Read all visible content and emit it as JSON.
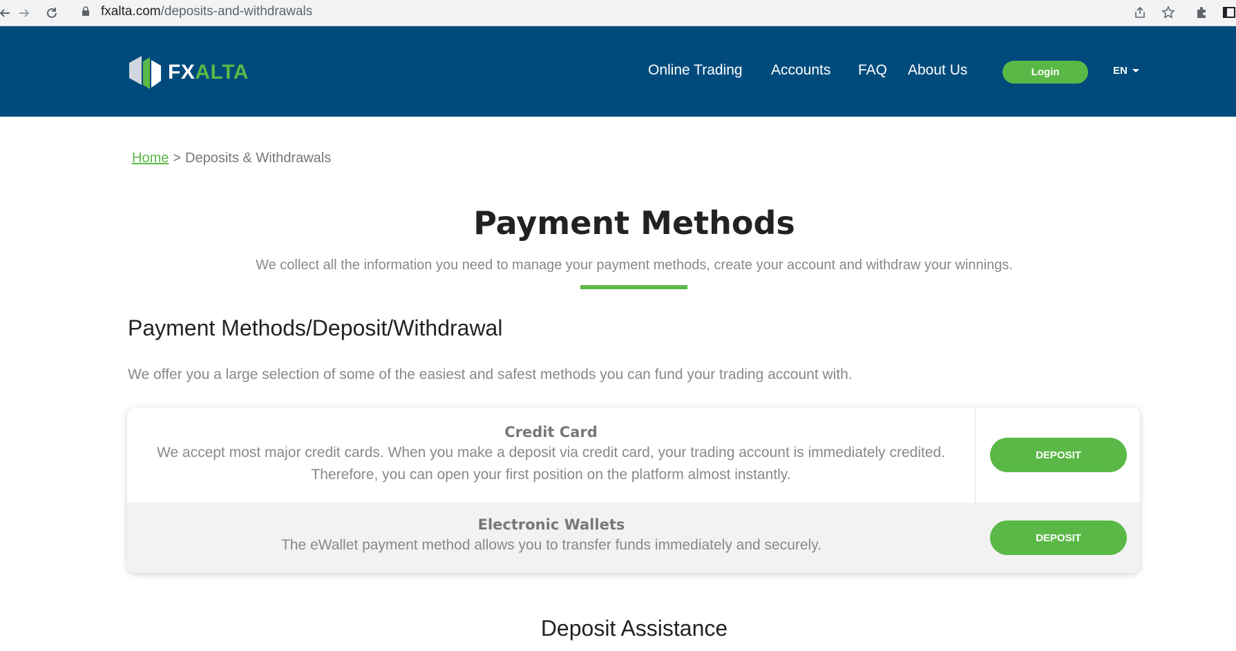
{
  "browser": {
    "url_host": "fxalta.com",
    "url_path": "/deposits-and-withdrawals"
  },
  "header": {
    "logo": {
      "fx": "FX",
      "alta": "ALTA"
    },
    "nav": [
      {
        "label": "Online Trading"
      },
      {
        "label": "Accounts"
      },
      {
        "label": "FAQ"
      },
      {
        "label": "About Us"
      }
    ],
    "login_label": "Login",
    "language": "EN"
  },
  "breadcrumb": {
    "home": "Home",
    "separator": ">",
    "current": "Deposits & Withdrawals"
  },
  "hero": {
    "title": "Payment Methods",
    "subtitle": "We collect all the information you need to manage your payment methods, create your account and withdraw your winnings."
  },
  "section": {
    "title": "Payment Methods/Deposit/Withdrawal",
    "description": "We offer you a large selection of some of the easiest and safest methods you can fund your trading account with."
  },
  "payment_methods": [
    {
      "name": "Credit Card",
      "description": "We accept most major credit cards. When you make a deposit via credit card, your trading account is immediately credited. Therefore, you can open your first position on the platform almost instantly.",
      "button": "DEPOSIT"
    },
    {
      "name": "Electronic Wallets",
      "description": "The eWallet payment method allows you to transfer funds immediately and securely.",
      "button": "DEPOSIT"
    }
  ],
  "assistance": {
    "title": "Deposit Assistance"
  },
  "colors": {
    "header_bg": "#004b7c",
    "accent_green": "#5ab846"
  }
}
